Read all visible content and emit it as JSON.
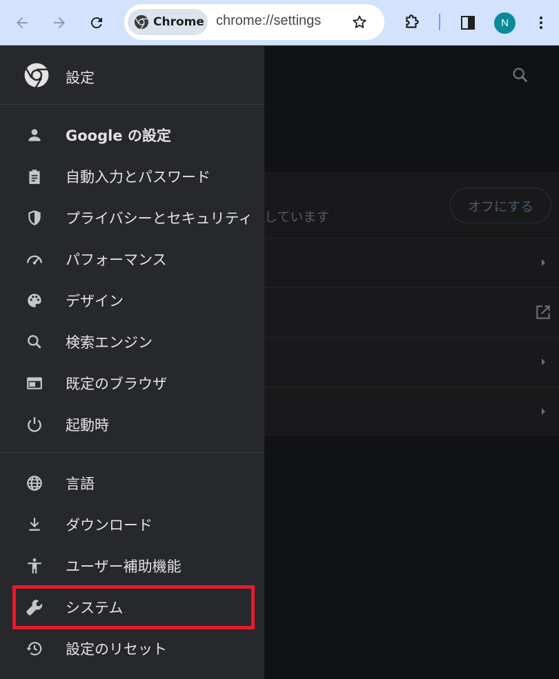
{
  "toolbar": {
    "chip_label": "Chrome",
    "url": "chrome://settings",
    "avatar_initial": "N"
  },
  "drawer": {
    "title": "設定",
    "items": [
      {
        "label": "Google の設定",
        "icon": "person-icon"
      },
      {
        "label": "自動入力とパスワード",
        "icon": "clipboard-icon"
      },
      {
        "label": "プライバシーとセキュリティ",
        "icon": "shield-icon"
      },
      {
        "label": "パフォーマンス",
        "icon": "speedometer-icon"
      },
      {
        "label": "デザイン",
        "icon": "palette-icon"
      },
      {
        "label": "検索エンジン",
        "icon": "search-icon"
      },
      {
        "label": "既定のブラウザ",
        "icon": "browser-window-icon"
      },
      {
        "label": "起動時",
        "icon": "power-icon"
      },
      {
        "label": "言語",
        "icon": "globe-icon"
      },
      {
        "label": "ダウンロード",
        "icon": "download-icon"
      },
      {
        "label": "ユーザー補助機能",
        "icon": "accessibility-icon"
      },
      {
        "label": "システム",
        "icon": "wrench-icon"
      },
      {
        "label": "設定のリセット",
        "icon": "history-icon"
      }
    ]
  },
  "background": {
    "partial_text": "しています",
    "off_button_label": "オフにする"
  },
  "colors": {
    "toolbar_bg": "#d3e3fd",
    "drawer_bg": "#27282b",
    "highlight_border": "#e8192c",
    "avatar_bg": "#0b8a9a"
  }
}
